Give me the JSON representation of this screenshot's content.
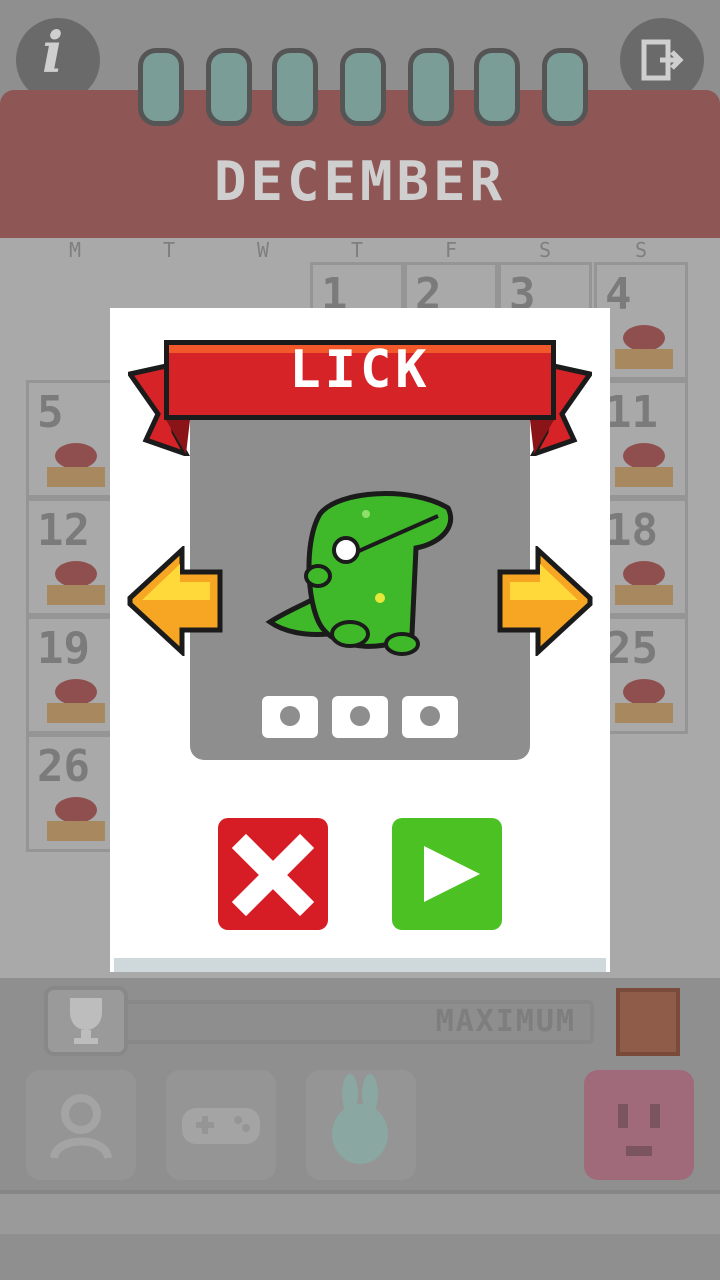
{
  "calendar": {
    "month": "DECEMBER",
    "weekdays": [
      "M",
      "T",
      "W",
      "T",
      "F",
      "S",
      "S"
    ],
    "visible_days": [
      "1",
      "2",
      "3",
      "4",
      "5",
      "11",
      "12",
      "18",
      "19",
      "25",
      "26"
    ]
  },
  "progress": {
    "label": "MAXIMUM",
    "level": 1.0
  },
  "modal": {
    "title": "LICK",
    "medals_count": 3
  },
  "icons": {
    "info": "i",
    "exit": "exit-door-icon",
    "trophy": "trophy-icon",
    "gift": "gift-icon",
    "cancel": "close-x-icon",
    "play": "play-triangle-icon"
  },
  "colors": {
    "banner_red": "#d62328",
    "cancel_red": "#d61d26",
    "play_green": "#4bc124",
    "creature_green": "#3fb82a",
    "arrow_orange": "#f6a623"
  }
}
